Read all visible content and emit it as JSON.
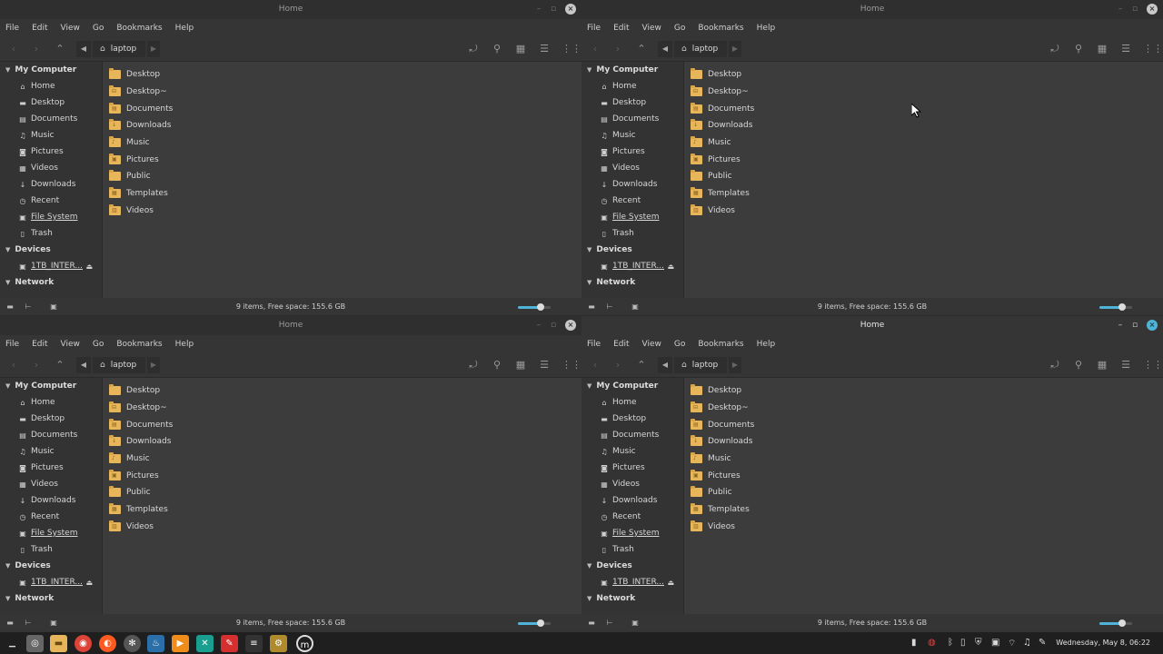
{
  "window": {
    "title": "Home",
    "menu": [
      "File",
      "Edit",
      "View",
      "Go",
      "Bookmarks",
      "Help"
    ],
    "location": "laptop",
    "status": "9 items, Free space: 155.6 GB",
    "zoom_level": 0.7
  },
  "sidebar": {
    "computer_header": "My Computer",
    "computer_items": [
      {
        "label": "Home",
        "icon": "home-icon"
      },
      {
        "label": "Desktop",
        "icon": "desktop-icon"
      },
      {
        "label": "Documents",
        "icon": "documents-icon"
      },
      {
        "label": "Music",
        "icon": "music-icon"
      },
      {
        "label": "Pictures",
        "icon": "pictures-icon"
      },
      {
        "label": "Videos",
        "icon": "videos-icon"
      },
      {
        "label": "Downloads",
        "icon": "downloads-icon"
      },
      {
        "label": "Recent",
        "icon": "recent-icon"
      },
      {
        "label": "File System",
        "icon": "filesystem-icon"
      },
      {
        "label": "Trash",
        "icon": "trash-icon"
      }
    ],
    "devices_header": "Devices",
    "device_label": "1TB_INTER...",
    "network_header": "Network"
  },
  "files": [
    {
      "name": "Desktop",
      "glyph": ""
    },
    {
      "name": "Desktop~",
      "glyph": "⊟"
    },
    {
      "name": "Documents",
      "glyph": "▤"
    },
    {
      "name": "Downloads",
      "glyph": "↓"
    },
    {
      "name": "Music",
      "glyph": "♪"
    },
    {
      "name": "Pictures",
      "glyph": "▣"
    },
    {
      "name": "Public",
      "glyph": ""
    },
    {
      "name": "Templates",
      "glyph": "▦"
    },
    {
      "name": "Videos",
      "glyph": "▥"
    }
  ],
  "taskbar": {
    "clock": "Wednesday, May 8, 06:22"
  },
  "colors": {
    "accent": "#4fb4d8",
    "folder": "#e8b65a",
    "window_bg": "#3c3c3c",
    "sidebar_bg": "#333333"
  }
}
